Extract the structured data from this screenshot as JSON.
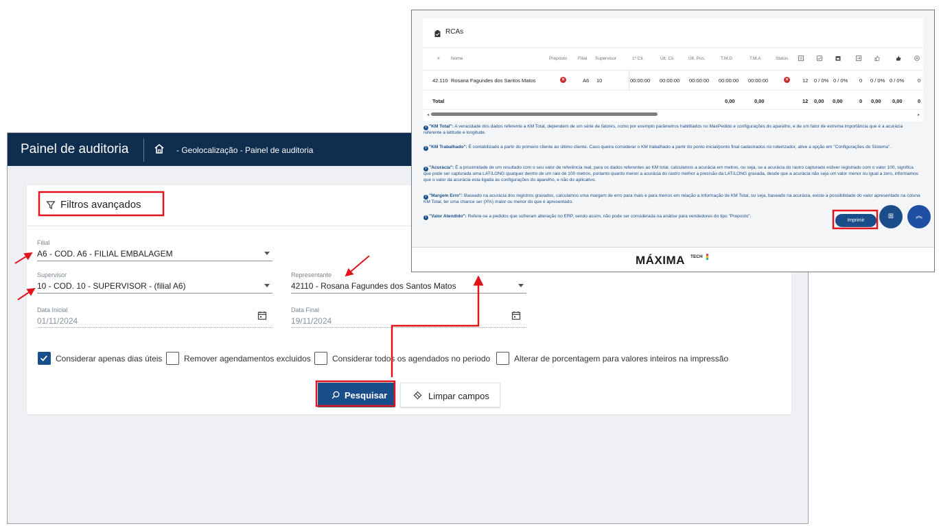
{
  "colors": {
    "navy": "#0f2d4e",
    "primary": "#1a4e8a",
    "annotation": "#e0141c",
    "danger": "#c9302c"
  },
  "back_window": {
    "app_title": "Painel de auditoria",
    "breadcrumb": "- Geolocalização - Painel de auditoria",
    "filter_title": "Filtros avançados",
    "fields": {
      "filial_label": "Filial",
      "filial_value": "A6 - COD. A6 - FILIAL EMBALAGEM",
      "supervisor_label": "Supervisor",
      "supervisor_value": "10 - COD. 10 - SUPERVISOR - (filial A6)",
      "representante_label": "Representante",
      "representante_value": "42110 - Rosana Fagundes dos Santos Matos",
      "data_inicial_label": "Data Inicial",
      "data_inicial_value": "01/11/2024",
      "data_final_label": "Data Final",
      "data_final_value": "19/11/2024"
    },
    "checkboxes": [
      {
        "label": "Considerar apenas dias úteis",
        "checked": true
      },
      {
        "label": "Remover agendamentos excluidos",
        "checked": false
      },
      {
        "label": "Considerar todos os agendados no periodo",
        "checked": false
      },
      {
        "label": "Alterar de porcentagem para valores inteiros na impressão",
        "checked": false
      }
    ],
    "buttons": {
      "search": "Pesquisar",
      "clear": "Limpar campos"
    }
  },
  "front_window": {
    "section_title": "RCAs",
    "columns": [
      "#",
      "Nome",
      "Preposto",
      "Filial",
      "Supervisor",
      "1º Cli.",
      "Últ. Cli.",
      "Últ. Pos.",
      "T.M.D",
      "T.M.A",
      "Status"
    ],
    "icon_columns": [
      "list-icon",
      "check-square-icon",
      "calendar-icon",
      "exit-icon",
      "thumbs-up-outline-icon",
      "thumbs-up-filled-icon",
      "plus-circle-icon"
    ],
    "row": {
      "id": "42.110",
      "name": "Rosana Fagundes dos Santos Matos",
      "filial": "A6",
      "supervisor": "10",
      "primeiro_cli": "00:00:00",
      "ult_cli": "00:00:00",
      "ult_pos": "00:00:00",
      "tmd": "00:00:00",
      "tma": "00:00:00",
      "c1": "12",
      "c2": "0 / 0%",
      "c3": "0 / 0%",
      "c4": "0",
      "c5": "0 / 0%",
      "c6": "0 / 0%",
      "c7": "0"
    },
    "total": {
      "label": "Total",
      "tmd": "0,00",
      "tma": "0,00",
      "c1": "12",
      "c2": "0,00",
      "c3": "0,00",
      "c4": "0",
      "c5": "0,00",
      "c6": "0,00",
      "c7": "0"
    },
    "notes": [
      {
        "key": "\"KM Total\":",
        "text": " A veracidade dos dados referente a KM Total, dependem de um série de fatores, como por exemplo parâmetros habilitados no MaxPedido e configurações do aparelho, e de um fator de extrema importância que é a acurácia referente a latitude e longitude."
      },
      {
        "key": "\"KM Trabalhado\":",
        "text": " É contabilizado a partir do primeiro cliente ao último cliente. Caso queira considerar o KM trabalhado a partir do ponto inicial/ponto final cadastrados no roteirizador, ative a opção em \"Configurações do Sistema\"."
      },
      {
        "key": "\"Acurácia\":",
        "text": " É a proximidade de um resultado com o seu valor de referência real, para os dados referentes ao KM total, calculamos a acurácia em metros, ou seja, se a acurácia do rastro capturado estiver registrado com o valor 100, significa que pode ser capturada uma LAT/LONG qualquer dentro de um raio de 100 metros, portanto quanto menor a acurácia do rastro melhor a precisão da LAT/LONG gravada, desde que a acurácia não seja um valor menor ou igual a zero, informamos que o valor da acurácia esta ligada as configurações do aparelho, e não do aplicativo."
      },
      {
        "key": "\"Margem Erro\":",
        "text": " Baseado na acurácia dos registros gravados, calculamos uma margem de erro para mais e para menos em relação a informação de KM Total, ou seja, baseado na acurácia, existe a possibilidade do valor apresentado na coluna KM Total, ter uma chance ser (X%) maior ou menor do que é apresentado."
      },
      {
        "key": "\"Valor Atendido\":",
        "text": " Refere-se a pedidos que sofreram alteração no ERP, sendo assim, não pode ser considerada na análise para vendedores do tipo \"Preposto\"."
      }
    ],
    "print_button": "Imprimir",
    "brand": "MÁXIMA",
    "brand_suffix": "TECH"
  }
}
